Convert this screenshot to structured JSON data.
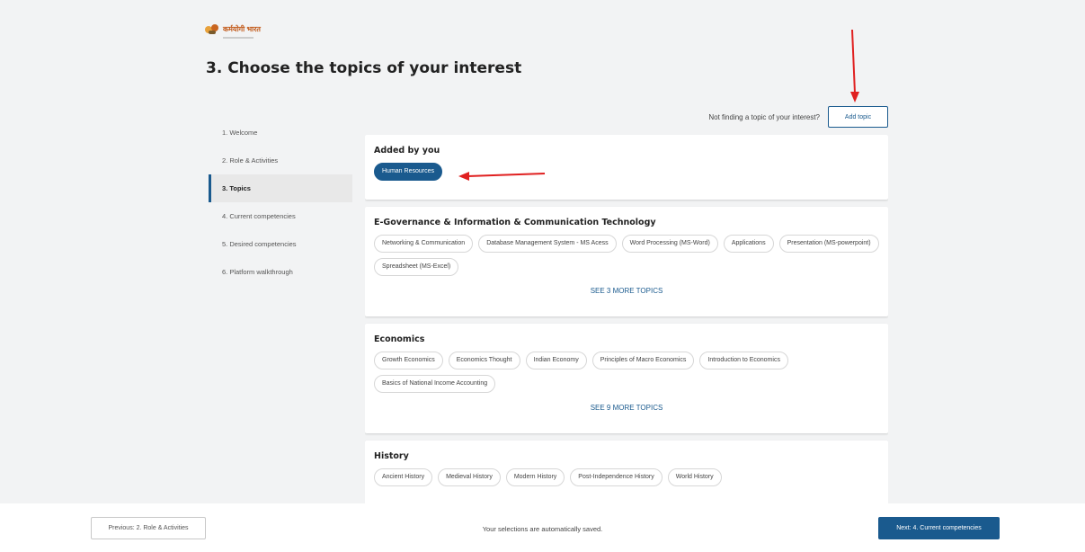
{
  "logo": {
    "text": "कर्मयोगी भारत"
  },
  "page_title": "3. Choose the topics of your interest",
  "steps": [
    {
      "label": "1. Welcome"
    },
    {
      "label": "2. Role & Activities"
    },
    {
      "label": "3. Topics"
    },
    {
      "label": "4. Current competencies"
    },
    {
      "label": "5. Desired competencies"
    },
    {
      "label": "6. Platform walkthrough"
    }
  ],
  "add_topic": {
    "hint": "Not finding a topic of your interest?",
    "button": "Add topic"
  },
  "sections": {
    "added": {
      "title": "Added by you",
      "chips": [
        "Human Resources"
      ]
    },
    "egov": {
      "title": "E-Governance & Information & Communication Technology",
      "chips": [
        "Networking & Communication",
        "Database Management System - MS Acess",
        "Word Processing (MS-Word)",
        "Applications",
        "Presentation (MS-powerpoint)",
        "Spreadsheet (MS-Excel)"
      ],
      "see_more": "SEE 3 MORE TOPICS"
    },
    "econ": {
      "title": "Economics",
      "chips": [
        "Growth Economics",
        "Economics Thought",
        "Indian Economy",
        "Principles of Macro Economics",
        "Introduction to Economics",
        "Basics of National Income Accounting"
      ],
      "see_more": "SEE 9 MORE TOPICS"
    },
    "hist": {
      "title": "History",
      "chips": [
        "Ancient History",
        "Medieval History",
        "Modern History",
        "Post-Independence History",
        "World History"
      ]
    }
  },
  "footer": {
    "prev": "Previous: 2. Role & Activities",
    "saved": "Your selections are automatically saved.",
    "next": "Next: 4. Current competencies"
  },
  "colors": {
    "primary": "#1a5a8e",
    "annotation": "#e02020"
  }
}
